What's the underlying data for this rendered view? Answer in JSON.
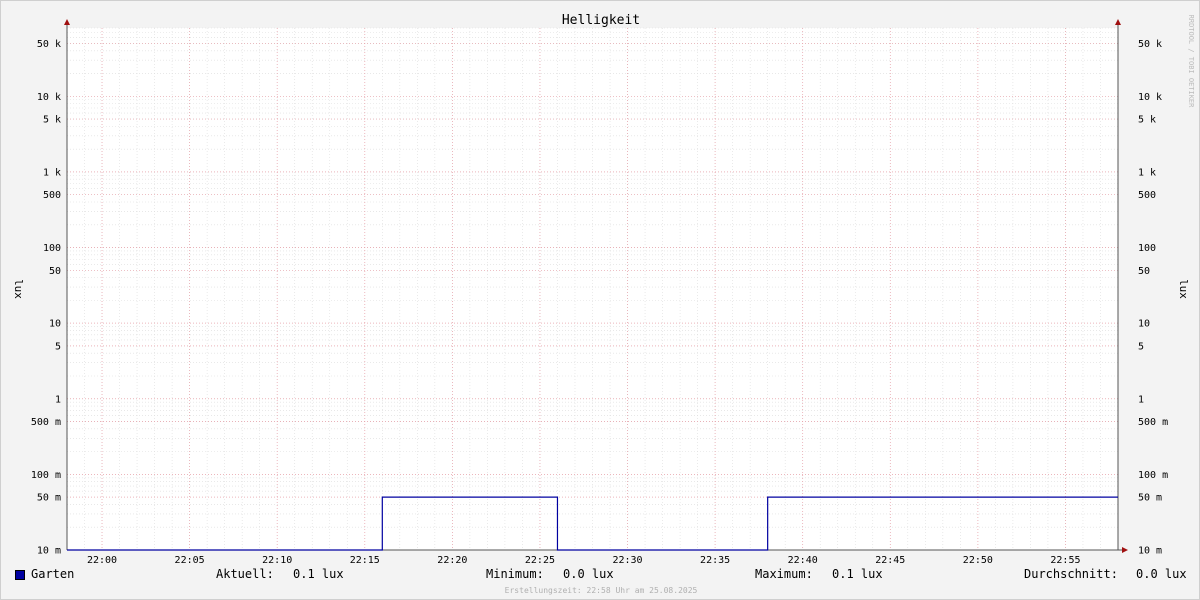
{
  "chart_data": {
    "type": "line",
    "title": "Helligkeit",
    "ylabel_left": "lux",
    "ylabel_right": "lux",
    "yscale": "log",
    "ylim": [
      0.01,
      80000
    ],
    "y_ticks": [
      {
        "value": 0.01,
        "label": "10 m"
      },
      {
        "value": 0.05,
        "label": "50 m"
      },
      {
        "value": 0.1,
        "label": "100 m"
      },
      {
        "value": 0.5,
        "label": "500 m"
      },
      {
        "value": 1,
        "label": "1"
      },
      {
        "value": 5,
        "label": "5"
      },
      {
        "value": 10,
        "label": "10"
      },
      {
        "value": 50,
        "label": "50"
      },
      {
        "value": 100,
        "label": "100"
      },
      {
        "value": 500,
        "label": "500"
      },
      {
        "value": 1000,
        "label": "1 k"
      },
      {
        "value": 5000,
        "label": "5 k"
      },
      {
        "value": 10000,
        "label": "10 k"
      },
      {
        "value": 50000,
        "label": "50 k"
      }
    ],
    "x_ticks": [
      "22:00",
      "22:05",
      "22:10",
      "22:15",
      "22:20",
      "22:25",
      "22:30",
      "22:35",
      "22:40",
      "22:45",
      "22:50",
      "22:55"
    ],
    "xlim": [
      "21:58",
      "22:58"
    ],
    "grid": true,
    "series": [
      {
        "name": "Garten",
        "color": "#0000a0",
        "points": [
          {
            "x": "21:58",
            "y": 0.01
          },
          {
            "x": "22:16",
            "y": 0.01
          },
          {
            "x": "22:16",
            "y": 0.05
          },
          {
            "x": "22:26",
            "y": 0.05
          },
          {
            "x": "22:26",
            "y": 0.01
          },
          {
            "x": "22:38",
            "y": 0.01
          },
          {
            "x": "22:38",
            "y": 0.05
          },
          {
            "x": "22:58",
            "y": 0.05
          }
        ]
      }
    ]
  },
  "legend": {
    "series_name": "Garten",
    "aktuell_label": "Aktuell:",
    "aktuell_value": "0.1 lux",
    "minimum_label": "Minimum:",
    "minimum_value": "0.0 lux",
    "maximum_label": "Maximum:",
    "maximum_value": "0.1 lux",
    "durchschnitt_label": "Durchschnitt:",
    "durchschnitt_value": "0.0 lux"
  },
  "watermark": "RRDTOOL / TOBI OETIKER",
  "footer": "Erstellungszeit: 22:58 Uhr am 25.08.2025"
}
